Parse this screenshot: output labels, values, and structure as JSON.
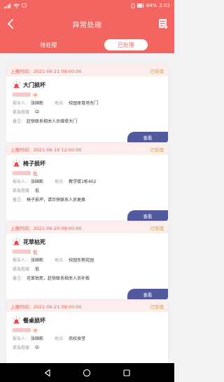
{
  "statusbar": {
    "battery": "84%",
    "time": "2:02"
  },
  "header": {
    "title": "异常处理"
  },
  "tabs": [
    {
      "label": "待处理",
      "active": false
    },
    {
      "label": "已处理",
      "active": true
    }
  ],
  "labels": {
    "reporter": "报告人:",
    "location": "地点:",
    "urgency": "紧急程度:",
    "remark": "备注:",
    "view": "查看"
  },
  "cards": [
    {
      "report_time": "上报时间：2021-06-21 09:00:00",
      "status": "已处理",
      "title": "大门损坏",
      "level": "中",
      "reporter": "张国栋",
      "location": "校园体育场东门",
      "urgency": "中",
      "remark": "赶快联系相关人员维修大门"
    },
    {
      "report_time": "上报时间：2021-06-19 12:00:00",
      "status": "已处理",
      "title": "椅子损坏",
      "level": "低",
      "reporter": "张国栋",
      "location": "教学楼1栋402",
      "urgency": "低",
      "remark": "椅子损坏，请尽快联系人员更换"
    },
    {
      "report_time": "上报时间：2021-06-20 09:00:00",
      "status": "已处理",
      "title": "花草枯死",
      "level": "低",
      "reporter": "张国栋",
      "location": "校园东侧花园",
      "urgency": "低",
      "remark": "花草枯死，赶快联系相关人员补栽"
    },
    {
      "report_time": "上报时间：2021-06-21 09:00:00",
      "status": "已处理",
      "title": "餐桌损坏",
      "level": "中",
      "reporter": "张国栋",
      "location": "南校食堂",
      "urgency": "中",
      "remark": ""
    }
  ],
  "colors": {
    "brand": "#f26560",
    "status": "#e0a020",
    "button": "#515a9a"
  }
}
